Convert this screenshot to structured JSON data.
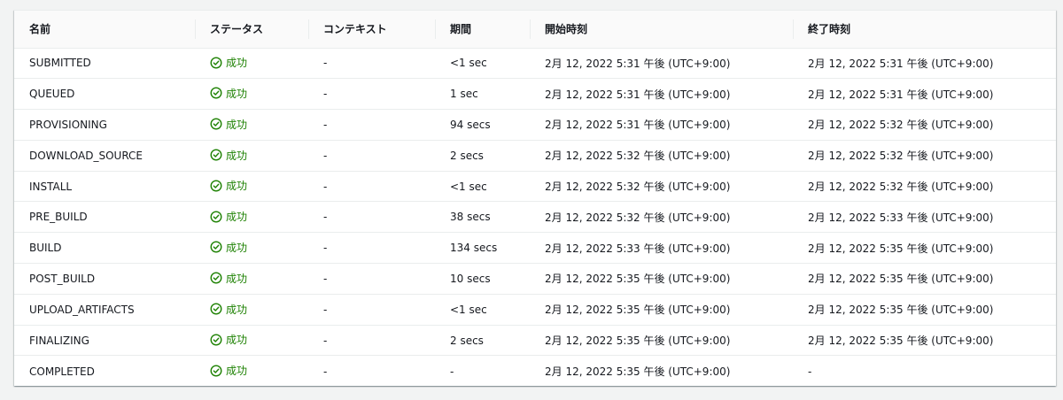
{
  "colors": {
    "success": "#1d8102",
    "background": "#f2f3f3",
    "panel": "#ffffff",
    "border": "#eaeded"
  },
  "table": {
    "headers": [
      "名前",
      "ステータス",
      "コンテキスト",
      "期間",
      "開始時刻",
      "終了時刻"
    ],
    "rows": [
      {
        "name": "SUBMITTED",
        "status": "成功",
        "status_icon": "check-circle-icon",
        "context": "-",
        "duration": "<1 sec",
        "start": "2月 12, 2022 5:31 午後 (UTC+9:00)",
        "end": "2月 12, 2022 5:31 午後 (UTC+9:00)"
      },
      {
        "name": "QUEUED",
        "status": "成功",
        "status_icon": "check-circle-icon",
        "context": "-",
        "duration": "1 sec",
        "start": "2月 12, 2022 5:31 午後 (UTC+9:00)",
        "end": "2月 12, 2022 5:31 午後 (UTC+9:00)"
      },
      {
        "name": "PROVISIONING",
        "status": "成功",
        "status_icon": "check-circle-icon",
        "context": "-",
        "duration": "94 secs",
        "start": "2月 12, 2022 5:31 午後 (UTC+9:00)",
        "end": "2月 12, 2022 5:32 午後 (UTC+9:00)"
      },
      {
        "name": "DOWNLOAD_SOURCE",
        "status": "成功",
        "status_icon": "check-circle-icon",
        "context": "-",
        "duration": "2 secs",
        "start": "2月 12, 2022 5:32 午後 (UTC+9:00)",
        "end": "2月 12, 2022 5:32 午後 (UTC+9:00)"
      },
      {
        "name": "INSTALL",
        "status": "成功",
        "status_icon": "check-circle-icon",
        "context": "-",
        "duration": "<1 sec",
        "start": "2月 12, 2022 5:32 午後 (UTC+9:00)",
        "end": "2月 12, 2022 5:32 午後 (UTC+9:00)"
      },
      {
        "name": "PRE_BUILD",
        "status": "成功",
        "status_icon": "check-circle-icon",
        "context": "-",
        "duration": "38 secs",
        "start": "2月 12, 2022 5:32 午後 (UTC+9:00)",
        "end": "2月 12, 2022 5:33 午後 (UTC+9:00)"
      },
      {
        "name": "BUILD",
        "status": "成功",
        "status_icon": "check-circle-icon",
        "context": "-",
        "duration": "134 secs",
        "start": "2月 12, 2022 5:33 午後 (UTC+9:00)",
        "end": "2月 12, 2022 5:35 午後 (UTC+9:00)"
      },
      {
        "name": "POST_BUILD",
        "status": "成功",
        "status_icon": "check-circle-icon",
        "context": "-",
        "duration": "10 secs",
        "start": "2月 12, 2022 5:35 午後 (UTC+9:00)",
        "end": "2月 12, 2022 5:35 午後 (UTC+9:00)"
      },
      {
        "name": "UPLOAD_ARTIFACTS",
        "status": "成功",
        "status_icon": "check-circle-icon",
        "context": "-",
        "duration": "<1 sec",
        "start": "2月 12, 2022 5:35 午後 (UTC+9:00)",
        "end": "2月 12, 2022 5:35 午後 (UTC+9:00)"
      },
      {
        "name": "FINALIZING",
        "status": "成功",
        "status_icon": "check-circle-icon",
        "context": "-",
        "duration": "2 secs",
        "start": "2月 12, 2022 5:35 午後 (UTC+9:00)",
        "end": "2月 12, 2022 5:35 午後 (UTC+9:00)"
      },
      {
        "name": "COMPLETED",
        "status": "成功",
        "status_icon": "check-circle-icon",
        "context": "-",
        "duration": "-",
        "start": "2月 12, 2022 5:35 午後 (UTC+9:00)",
        "end": "-"
      }
    ]
  }
}
